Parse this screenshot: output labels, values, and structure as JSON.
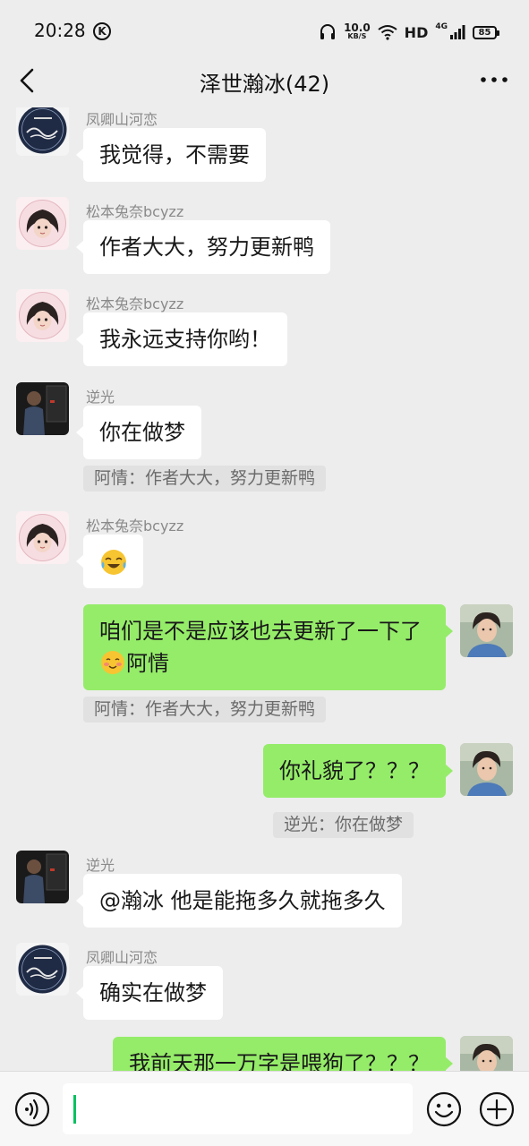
{
  "status_bar": {
    "time": "20:28",
    "k_badge": "K",
    "net_speed": "10.0",
    "net_unit": "KB/S",
    "hd": "HD",
    "signal_label": "4G",
    "battery": "85"
  },
  "header": {
    "title": "泽世瀚冰(42)",
    "back_icon": "chevron-left-icon",
    "more_icon": "more-dots-icon"
  },
  "messages": [
    {
      "sender": "凤卿山河恋",
      "text": "我觉得，不需要",
      "side": "left",
      "avatar": "avatar-ink-logo"
    },
    {
      "sender": "松本兔奈bcyzz",
      "text": "作者大大，努力更新鸭",
      "side": "left",
      "avatar": "avatar-anime-girl"
    },
    {
      "sender": "松本兔奈bcyzz",
      "text": "我永远支持你哟！",
      "side": "left",
      "avatar": "avatar-anime-girl"
    },
    {
      "sender": "逆光",
      "text": "你在做梦",
      "side": "left",
      "avatar": "avatar-dark-photo",
      "quote": "阿情：作者大大，努力更新鸭"
    },
    {
      "sender": "松本兔奈bcyzz",
      "emoji": "crying-laughing-emoji",
      "side": "left",
      "avatar": "avatar-anime-girl"
    },
    {
      "text_line1": "咱们是不是应该也去更新了一下了",
      "text_line2": "阿情",
      "inline_emoji": "blushing-smile-emoji",
      "side": "right",
      "avatar": "avatar-young-man",
      "quote": "阿情：作者大大，努力更新鸭"
    },
    {
      "text": "你礼貌了？？？",
      "side": "right",
      "avatar": "avatar-young-man",
      "quote": "逆光：你在做梦"
    },
    {
      "sender": "逆光",
      "text": "@瀚冰  他是能拖多久就拖多久",
      "side": "left",
      "avatar": "avatar-dark-photo"
    },
    {
      "sender": "凤卿山河恋",
      "text": "确实在做梦",
      "side": "left",
      "avatar": "avatar-ink-logo"
    },
    {
      "text": "我前天那一万字是喂狗了？？？",
      "side": "right",
      "avatar": "avatar-young-man"
    }
  ],
  "input_bar": {
    "voice_icon": "voice-icon",
    "input_value": "",
    "emoji_icon": "emoji-icon",
    "plus_icon": "plus-icon"
  },
  "colors": {
    "background": "#ededed",
    "bubble_self": "#95ec69",
    "bubble_other": "#ffffff",
    "quote_bg": "#e1e1e1",
    "caret": "#07c160"
  }
}
